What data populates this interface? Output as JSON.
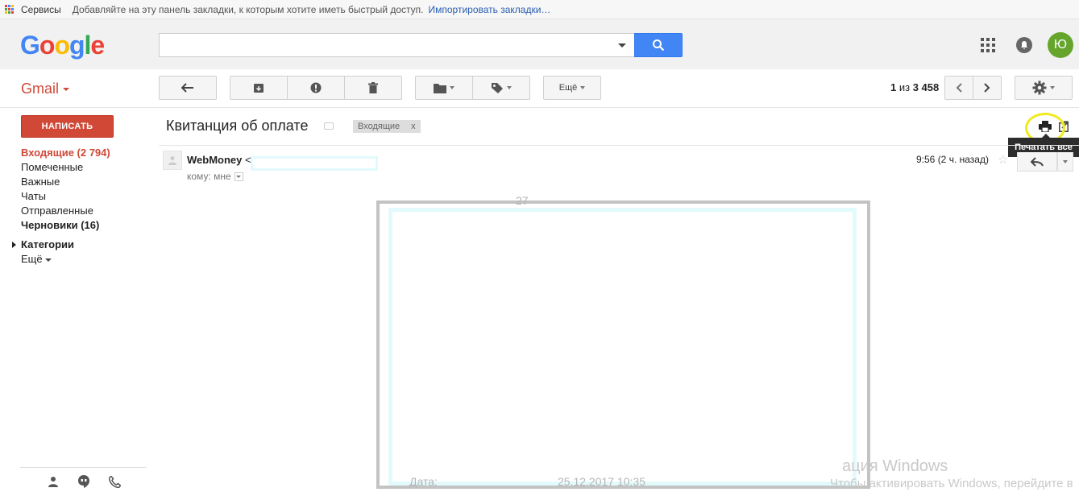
{
  "bookmarks_bar": {
    "apps_label": "Сервисы",
    "hint": "Добавляйте на эту панель закладки, к которым хотите иметь быстрый доступ.",
    "import_link": "Импортировать закладки…"
  },
  "header": {
    "logo": "Google",
    "logo_colors": [
      "#4285f4",
      "#ea4335",
      "#fbbc05",
      "#4285f4",
      "#34a853",
      "#ea4335"
    ],
    "search_value": "",
    "avatar_initial": "Ю",
    "avatar_color": "#65a52c"
  },
  "toolbar": {
    "app_name": "Gmail",
    "more_label": "Ещё",
    "pager_range": "1",
    "pager_of": "из",
    "pager_total": "3 458"
  },
  "sidebar": {
    "compose_label": "НАПИСАТЬ",
    "items": [
      {
        "label": "Входящие (2 794)",
        "state": "active"
      },
      {
        "label": "Помеченные",
        "state": "normal"
      },
      {
        "label": "Важные",
        "state": "normal"
      },
      {
        "label": "Чаты",
        "state": "normal"
      },
      {
        "label": "Отправленные",
        "state": "normal"
      },
      {
        "label": "Черновики (16)",
        "state": "bold"
      }
    ],
    "categories_label": "Категории",
    "more_label": "Ещё"
  },
  "message": {
    "subject": "Квитанция об оплате",
    "label_chip": "Входящие",
    "label_remove": "x",
    "print_tooltip": "Печатать все",
    "sender_name": "WebMoney",
    "sender_bracket": "<",
    "to_line": "кому: мне",
    "timestamp": "9:56 (2 ч. назад)",
    "body_peek_top": "27",
    "body_peek_label": "Дата:",
    "body_peek_value": "25.12.2017 10:35"
  },
  "watermark": {
    "line1": "ация Windows",
    "line2": "Чтобы активировать Windows, перейдите в"
  }
}
